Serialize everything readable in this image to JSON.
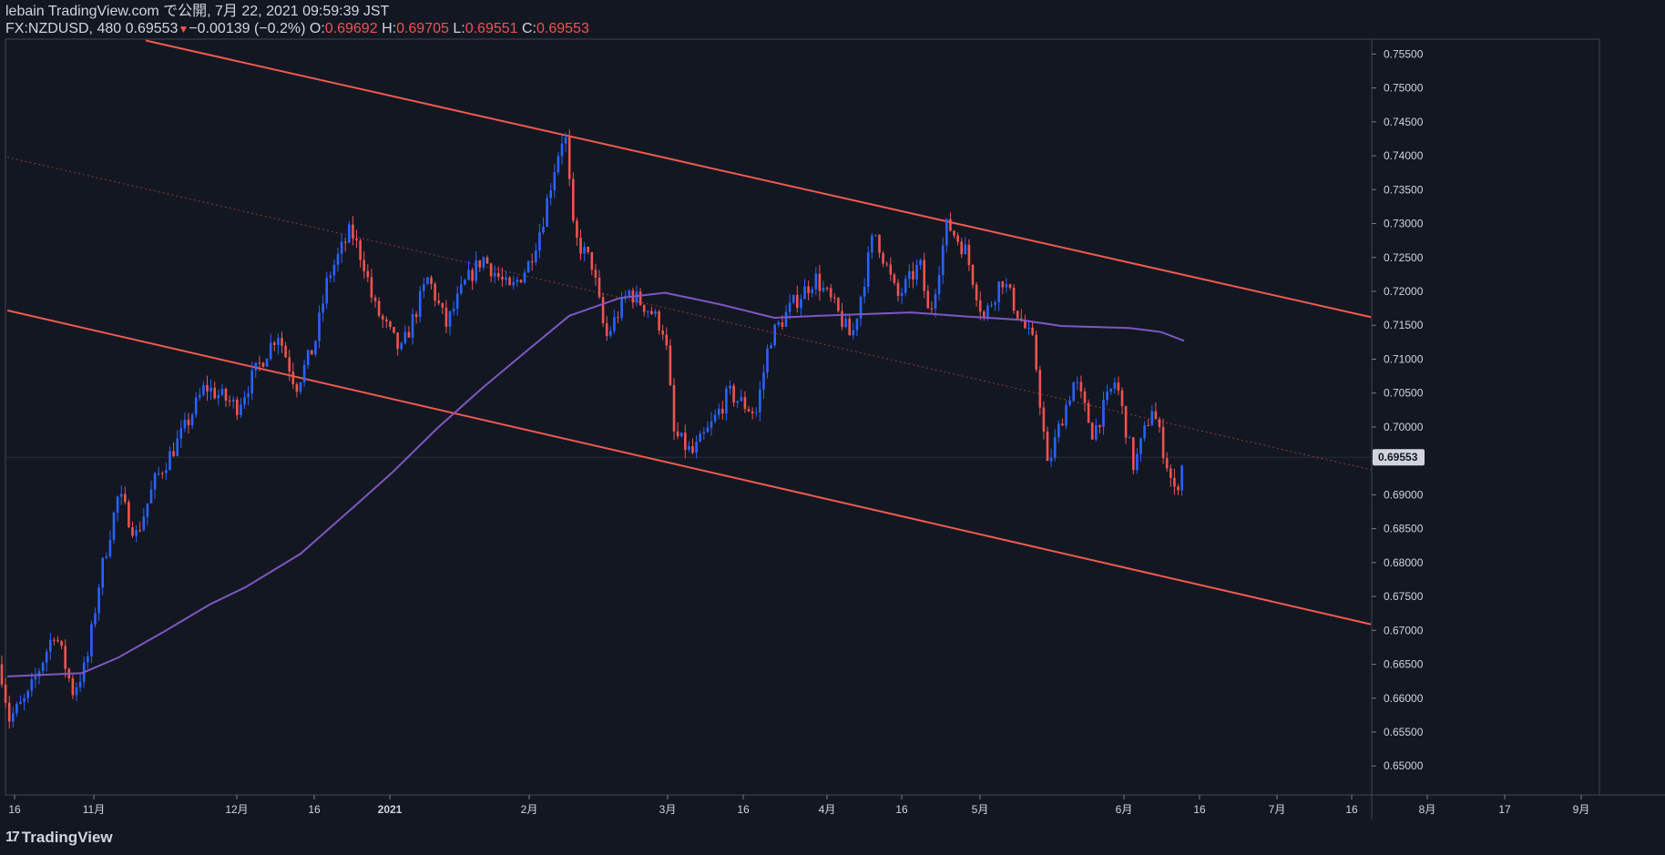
{
  "header": {
    "publish_line": "lebain TradingView.com で公開, 7月 22, 2021 09:59:39 JST",
    "symbol": "FX:NZDUSD, 480",
    "last": "0.69553",
    "change": "−0.00139 (−0.2%)",
    "o_label": "O:",
    "o_value": "0.69692",
    "h_label": "H:",
    "h_value": "0.69705",
    "l_label": "L:",
    "l_value": "0.69551",
    "c_label": "C:",
    "c_value": "0.69553"
  },
  "footer": {
    "brand": "TradingView",
    "logo_icon": "tradingview-logo-icon"
  },
  "colors": {
    "background": "#131722",
    "up": "#2962ff",
    "down": "#ef5350",
    "channel": "#f05a50",
    "ma": "#7e57c2",
    "text": "#d1d4dc",
    "grid_line": "#2a2e39"
  },
  "chart_data": {
    "type": "candlestick",
    "symbol": "FX:NZDUSD",
    "timeframe": "480",
    "y_ticks": [
      "0.75500",
      "0.75000",
      "0.74500",
      "0.74000",
      "0.73500",
      "0.73000",
      "0.72500",
      "0.72000",
      "0.71500",
      "0.71000",
      "0.70500",
      "0.70000",
      "0.69500",
      "0.69000",
      "0.68500",
      "0.68000",
      "0.67500",
      "0.67000",
      "0.66500",
      "0.66000",
      "0.65500",
      "0.65000"
    ],
    "ylim": [
      0.6465,
      0.7585
    ],
    "x_ticks": [
      "16",
      "11月",
      "12月",
      "16",
      "2021",
      "2月",
      "3月",
      "16",
      "4月",
      "16",
      "5月",
      "6月",
      "16",
      "7月",
      "16",
      "8月",
      "17",
      "9月"
    ],
    "current_price_label": "0.69553",
    "price_path": [
      {
        "t": 0,
        "p": 0.665
      },
      {
        "t": 10,
        "p": 0.657
      },
      {
        "t": 30,
        "p": 0.66
      },
      {
        "t": 60,
        "p": 0.67
      },
      {
        "t": 80,
        "p": 0.661
      },
      {
        "t": 95,
        "p": 0.665
      },
      {
        "t": 110,
        "p": 0.678
      },
      {
        "t": 130,
        "p": 0.69
      },
      {
        "t": 150,
        "p": 0.684
      },
      {
        "t": 170,
        "p": 0.692
      },
      {
        "t": 200,
        "p": 0.699
      },
      {
        "t": 225,
        "p": 0.706
      },
      {
        "t": 260,
        "p": 0.703
      },
      {
        "t": 280,
        "p": 0.708
      },
      {
        "t": 305,
        "p": 0.714
      },
      {
        "t": 325,
        "p": 0.706
      },
      {
        "t": 345,
        "p": 0.712
      },
      {
        "t": 360,
        "p": 0.722
      },
      {
        "t": 385,
        "p": 0.729
      },
      {
        "t": 400,
        "p": 0.724
      },
      {
        "t": 410,
        "p": 0.718
      },
      {
        "t": 440,
        "p": 0.711
      },
      {
        "t": 470,
        "p": 0.722
      },
      {
        "t": 490,
        "p": 0.715
      },
      {
        "t": 510,
        "p": 0.721
      },
      {
        "t": 530,
        "p": 0.725
      },
      {
        "t": 560,
        "p": 0.72
      },
      {
        "t": 580,
        "p": 0.724
      },
      {
        "t": 595,
        "p": 0.73
      },
      {
        "t": 610,
        "p": 0.739
      },
      {
        "t": 620,
        "p": 0.744
      },
      {
        "t": 630,
        "p": 0.728
      },
      {
        "t": 650,
        "p": 0.724
      },
      {
        "t": 665,
        "p": 0.713
      },
      {
        "t": 690,
        "p": 0.72
      },
      {
        "t": 715,
        "p": 0.717
      },
      {
        "t": 730,
        "p": 0.714
      },
      {
        "t": 740,
        "p": 0.699
      },
      {
        "t": 760,
        "p": 0.696
      },
      {
        "t": 780,
        "p": 0.7
      },
      {
        "t": 800,
        "p": 0.705
      },
      {
        "t": 830,
        "p": 0.702
      },
      {
        "t": 845,
        "p": 0.713
      },
      {
        "t": 870,
        "p": 0.718
      },
      {
        "t": 895,
        "p": 0.722
      },
      {
        "t": 915,
        "p": 0.718
      },
      {
        "t": 935,
        "p": 0.713
      },
      {
        "t": 960,
        "p": 0.729
      },
      {
        "t": 985,
        "p": 0.719
      },
      {
        "t": 1010,
        "p": 0.724
      },
      {
        "t": 1020,
        "p": 0.716
      },
      {
        "t": 1040,
        "p": 0.73
      },
      {
        "t": 1060,
        "p": 0.726
      },
      {
        "t": 1080,
        "p": 0.716
      },
      {
        "t": 1100,
        "p": 0.722
      },
      {
        "t": 1120,
        "p": 0.716
      },
      {
        "t": 1135,
        "p": 0.712
      },
      {
        "t": 1150,
        "p": 0.694
      },
      {
        "t": 1165,
        "p": 0.701
      },
      {
        "t": 1180,
        "p": 0.707
      },
      {
        "t": 1200,
        "p": 0.699
      },
      {
        "t": 1225,
        "p": 0.707
      },
      {
        "t": 1245,
        "p": 0.694
      },
      {
        "t": 1265,
        "p": 0.703
      },
      {
        "t": 1290,
        "p": 0.69
      },
      {
        "t": 1300,
        "p": 0.6955
      }
    ],
    "moving_average": [
      {
        "t": 8,
        "p": 0.6632
      },
      {
        "t": 90,
        "p": 0.6637
      },
      {
        "t": 130,
        "p": 0.666
      },
      {
        "t": 180,
        "p": 0.6698
      },
      {
        "t": 230,
        "p": 0.6738
      },
      {
        "t": 270,
        "p": 0.6764
      },
      {
        "t": 330,
        "p": 0.6813
      },
      {
        "t": 390,
        "p": 0.6884
      },
      {
        "t": 430,
        "p": 0.6932
      },
      {
        "t": 480,
        "p": 0.6998
      },
      {
        "t": 530,
        "p": 0.7058
      },
      {
        "t": 580,
        "p": 0.7114
      },
      {
        "t": 625,
        "p": 0.7164
      },
      {
        "t": 680,
        "p": 0.719
      },
      {
        "t": 730,
        "p": 0.7198
      },
      {
        "t": 790,
        "p": 0.7181
      },
      {
        "t": 850,
        "p": 0.7161
      },
      {
        "t": 900,
        "p": 0.7164
      },
      {
        "t": 1000,
        "p": 0.7169
      },
      {
        "t": 1060,
        "p": 0.7163
      },
      {
        "t": 1120,
        "p": 0.7158
      },
      {
        "t": 1165,
        "p": 0.7149
      },
      {
        "t": 1240,
        "p": 0.7146
      },
      {
        "t": 1275,
        "p": 0.714
      },
      {
        "t": 1300,
        "p": 0.7127
      }
    ],
    "channel": {
      "upper": [
        {
          "t": 160,
          "p": 0.757
        },
        {
          "t": 1505,
          "p": 0.7162
        }
      ],
      "middle": [
        {
          "t": 8,
          "p": 0.7398
        },
        {
          "t": 1505,
          "p": 0.6937
        }
      ],
      "lower": [
        {
          "t": 8,
          "p": 0.7172
        },
        {
          "t": 1505,
          "p": 0.6709
        }
      ]
    }
  }
}
